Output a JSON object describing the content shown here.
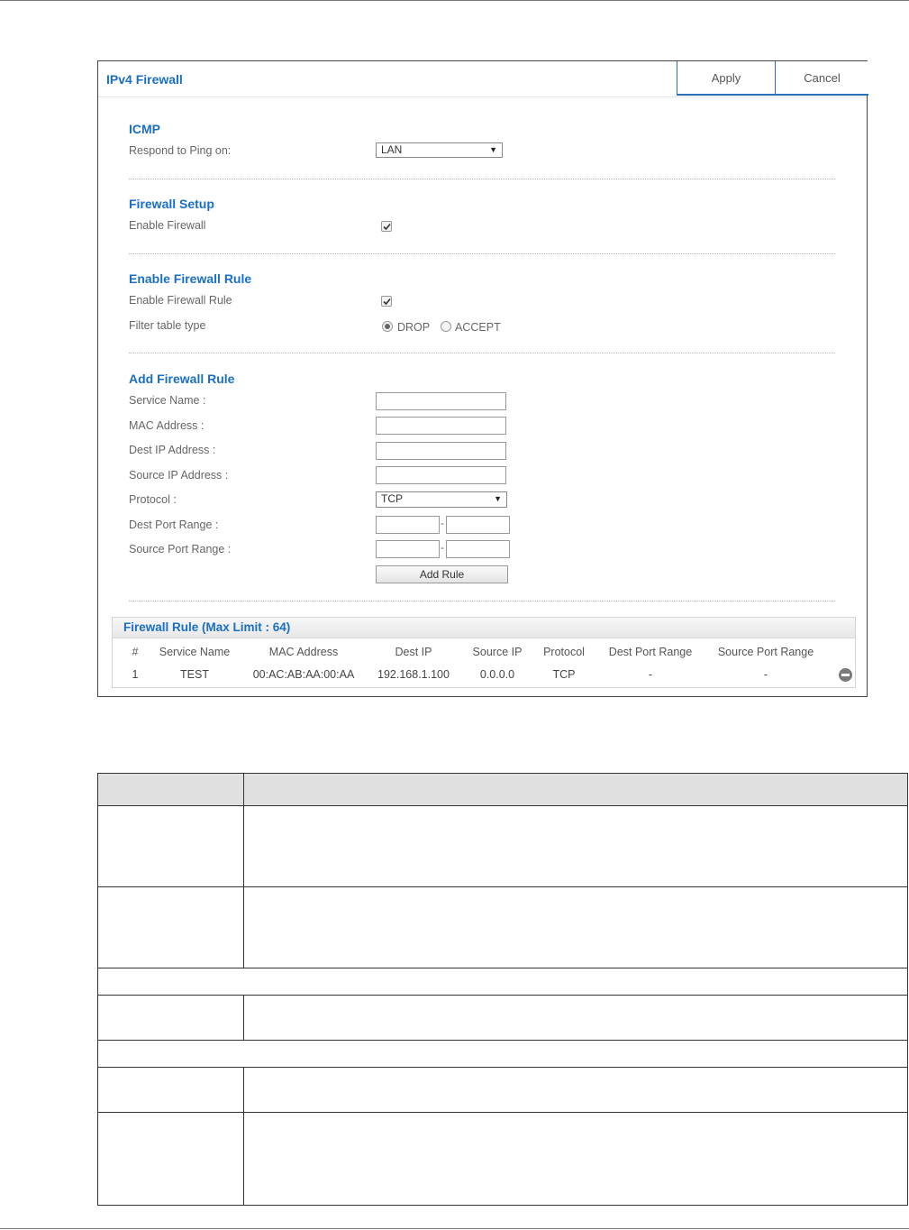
{
  "panel": {
    "title": "IPv4 Firewall",
    "apply_label": "Apply",
    "cancel_label": "Cancel"
  },
  "icmp": {
    "heading": "ICMP",
    "respond_label": "Respond to Ping on:",
    "respond_value": "LAN"
  },
  "firewall_setup": {
    "heading": "Firewall Setup",
    "enable_label": "Enable Firewall",
    "enable_checked": true
  },
  "firewall_rule": {
    "heading": "Enable Firewall Rule",
    "enable_label": "Enable Firewall Rule",
    "enable_checked": true,
    "filter_label": "Filter table type",
    "option_drop": "DROP",
    "option_accept": "ACCEPT",
    "selected": "DROP"
  },
  "add_rule": {
    "heading": "Add Firewall Rule",
    "service_name_label": "Service Name :",
    "mac_label": "MAC Address :",
    "dest_ip_label": "Dest IP Address :",
    "source_ip_label": "Source IP Address :",
    "protocol_label": "Protocol :",
    "protocol_value": "TCP",
    "dest_port_label": "Dest Port Range :",
    "source_port_label": "Source Port Range :",
    "range_sep": "-",
    "add_button": "Add Rule"
  },
  "rules_table": {
    "title": "Firewall Rule (Max Limit : 64)",
    "columns": [
      "#",
      "Service Name",
      "MAC Address",
      "Dest IP",
      "Source IP",
      "Protocol",
      "Dest Port Range",
      "Source Port Range"
    ],
    "rows": [
      [
        "1",
        "TEST",
        "00:AC:AB:AA:00:AA",
        "192.168.1.100",
        "0.0.0.0",
        "TCP",
        "-",
        "-"
      ]
    ]
  }
}
